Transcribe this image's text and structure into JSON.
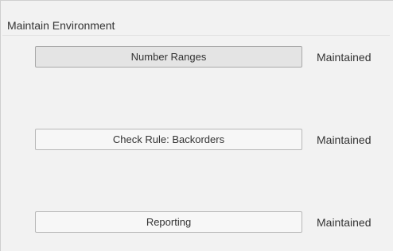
{
  "panel": {
    "title": "Maintain Environment"
  },
  "rows": [
    {
      "button_label": "Number Ranges",
      "status": "Maintained"
    },
    {
      "button_label": "Check Rule: Backorders",
      "status": "Maintained"
    },
    {
      "button_label": "Reporting",
      "status": "Maintained"
    }
  ],
  "colors": {
    "panel_background": "#f2f2f2",
    "button_background": "#f7f7f7",
    "button_active_background": "#e4e4e4",
    "button_border": "#b8b8b8",
    "text": "#333333"
  }
}
